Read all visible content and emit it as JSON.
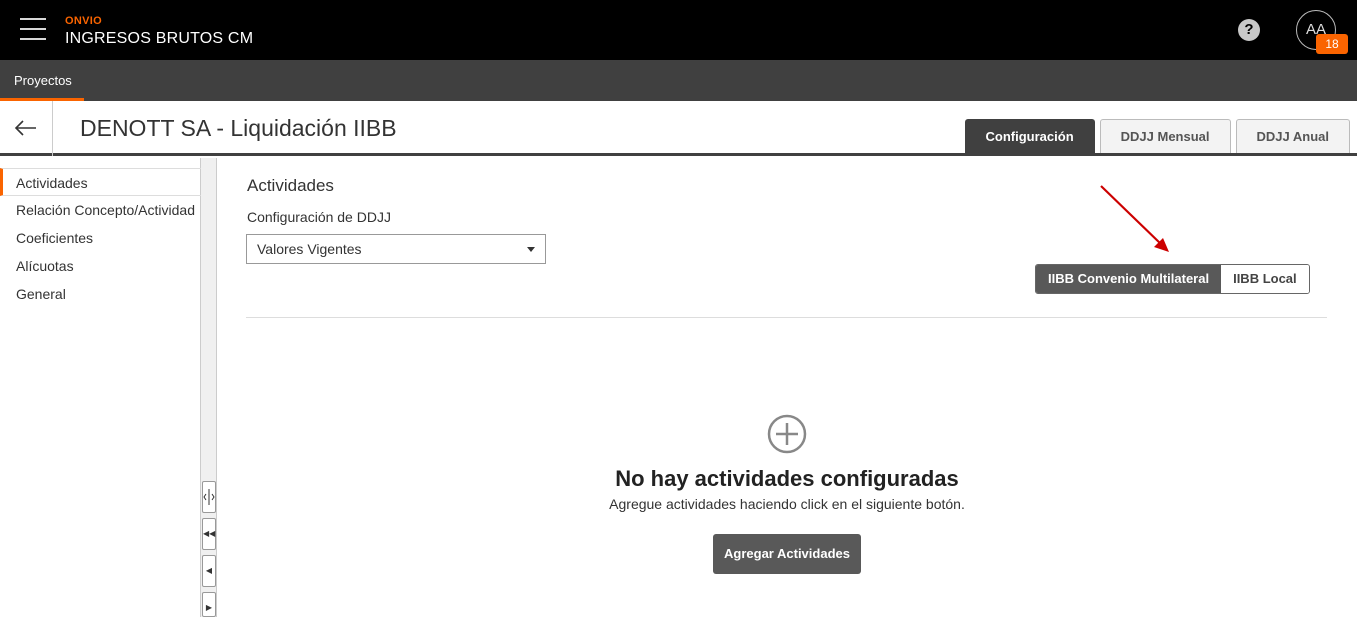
{
  "header": {
    "brand": "ONVIO",
    "app_title": "INGRESOS BRUTOS CM",
    "help_symbol": "?",
    "avatar_initials": "AA",
    "notification_count": "18"
  },
  "project_bar": {
    "tab_label": "Proyectos"
  },
  "page": {
    "title": "DENOTT SA - Liquidación IIBB",
    "tabs": [
      {
        "label": "Configuración",
        "active": true
      },
      {
        "label": "DDJJ Mensual",
        "active": false
      },
      {
        "label": "DDJJ Anual",
        "active": false
      }
    ]
  },
  "sidebar": {
    "items": [
      {
        "label": "Actividades",
        "active": true
      },
      {
        "label": "Relación Concepto/Actividad",
        "active": false
      },
      {
        "label": "Coeficientes",
        "active": false
      },
      {
        "label": "Alícuotas",
        "active": false
      },
      {
        "label": "General",
        "active": false
      }
    ]
  },
  "main": {
    "section_title": "Actividades",
    "config_label": "Configuración de DDJJ",
    "config_select_value": "Valores Vigentes",
    "toggle": {
      "option_1": "IIBB Convenio Multilateral",
      "option_2": "IIBB Local",
      "selected": "IIBB Convenio Multilateral"
    },
    "empty_state": {
      "title": "No hay actividades configuradas",
      "subtitle": "Agregue actividades haciendo click en el siguiente botón.",
      "button_label": "Agregar Actividades"
    }
  },
  "colors": {
    "accent": "#fa6400",
    "header_bg": "#000000",
    "bar_bg": "#404040",
    "annotation_arrow": "#cc0000"
  }
}
